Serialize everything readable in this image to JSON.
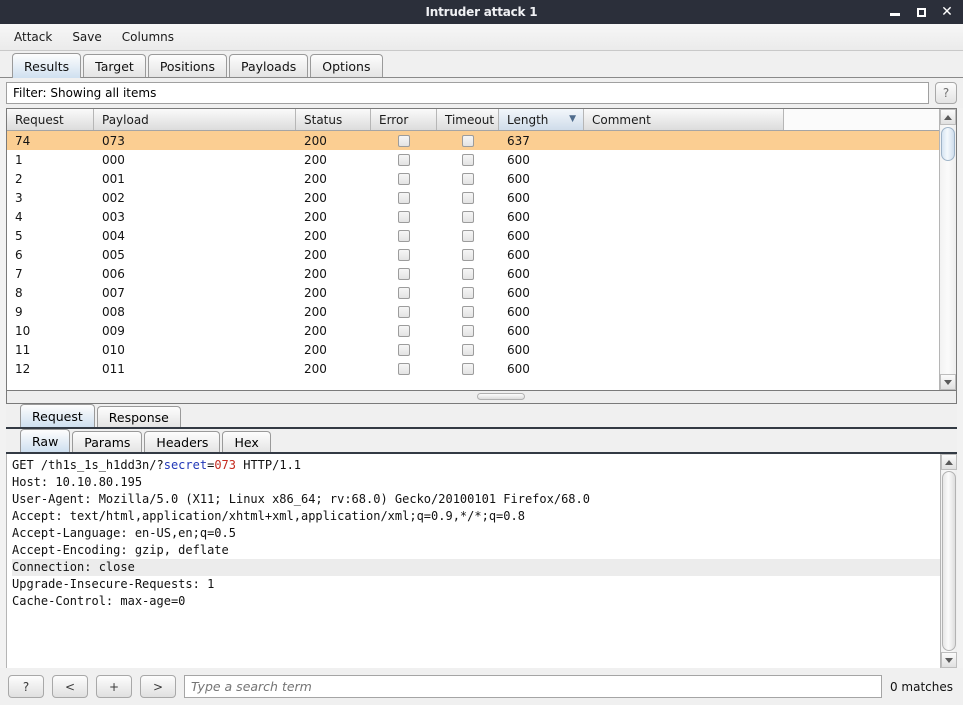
{
  "window": {
    "title": "Intruder attack 1",
    "minimize_label": "–",
    "maximize_label": "□",
    "close_label": "✕"
  },
  "menubar": {
    "items": [
      "Attack",
      "Save",
      "Columns"
    ]
  },
  "tabs": {
    "items": [
      "Results",
      "Target",
      "Positions",
      "Payloads",
      "Options"
    ],
    "active": "Results"
  },
  "filter": {
    "text": "Filter: Showing all items",
    "help_label": "?"
  },
  "results_table": {
    "columns": [
      "Request",
      "Payload",
      "Status",
      "Error",
      "Timeout",
      "Length",
      "Comment"
    ],
    "sorted_column": "Length",
    "sort_arrow": "▼",
    "rows": [
      {
        "request": "74",
        "payload": "073",
        "status": "200",
        "error": false,
        "timeout": false,
        "length": "637",
        "comment": "",
        "selected": true
      },
      {
        "request": "1",
        "payload": "000",
        "status": "200",
        "error": false,
        "timeout": false,
        "length": "600",
        "comment": "",
        "selected": false
      },
      {
        "request": "2",
        "payload": "001",
        "status": "200",
        "error": false,
        "timeout": false,
        "length": "600",
        "comment": "",
        "selected": false
      },
      {
        "request": "3",
        "payload": "002",
        "status": "200",
        "error": false,
        "timeout": false,
        "length": "600",
        "comment": "",
        "selected": false
      },
      {
        "request": "4",
        "payload": "003",
        "status": "200",
        "error": false,
        "timeout": false,
        "length": "600",
        "comment": "",
        "selected": false
      },
      {
        "request": "5",
        "payload": "004",
        "status": "200",
        "error": false,
        "timeout": false,
        "length": "600",
        "comment": "",
        "selected": false
      },
      {
        "request": "6",
        "payload": "005",
        "status": "200",
        "error": false,
        "timeout": false,
        "length": "600",
        "comment": "",
        "selected": false
      },
      {
        "request": "7",
        "payload": "006",
        "status": "200",
        "error": false,
        "timeout": false,
        "length": "600",
        "comment": "",
        "selected": false
      },
      {
        "request": "8",
        "payload": "007",
        "status": "200",
        "error": false,
        "timeout": false,
        "length": "600",
        "comment": "",
        "selected": false
      },
      {
        "request": "9",
        "payload": "008",
        "status": "200",
        "error": false,
        "timeout": false,
        "length": "600",
        "comment": "",
        "selected": false
      },
      {
        "request": "10",
        "payload": "009",
        "status": "200",
        "error": false,
        "timeout": false,
        "length": "600",
        "comment": "",
        "selected": false
      },
      {
        "request": "11",
        "payload": "010",
        "status": "200",
        "error": false,
        "timeout": false,
        "length": "600",
        "comment": "",
        "selected": false
      },
      {
        "request": "12",
        "payload": "011",
        "status": "200",
        "error": false,
        "timeout": false,
        "length": "600",
        "comment": "",
        "selected": false
      }
    ]
  },
  "message_panel": {
    "tabs": [
      "Request",
      "Response"
    ],
    "active_tab": "Request",
    "format_tabs": [
      "Raw",
      "Params",
      "Headers",
      "Hex"
    ],
    "active_format": "Raw",
    "request_lines": [
      {
        "segments": [
          {
            "text": "GET /th1s_1s_h1dd3n/?",
            "style": "plain"
          },
          {
            "text": "secret",
            "style": "key"
          },
          {
            "text": "=",
            "style": "plain"
          },
          {
            "text": "073",
            "style": "val"
          },
          {
            "text": " HTTP/1.1",
            "style": "plain"
          }
        ],
        "highlight": false
      },
      {
        "segments": [
          {
            "text": "Host: 10.10.80.195",
            "style": "plain"
          }
        ],
        "highlight": false
      },
      {
        "segments": [
          {
            "text": "User-Agent: Mozilla/5.0 (X11; Linux x86_64; rv:68.0) Gecko/20100101 Firefox/68.0",
            "style": "plain"
          }
        ],
        "highlight": false
      },
      {
        "segments": [
          {
            "text": "Accept: text/html,application/xhtml+xml,application/xml;q=0.9,*/*;q=0.8",
            "style": "plain"
          }
        ],
        "highlight": false
      },
      {
        "segments": [
          {
            "text": "Accept-Language: en-US,en;q=0.5",
            "style": "plain"
          }
        ],
        "highlight": false
      },
      {
        "segments": [
          {
            "text": "Accept-Encoding: gzip, deflate",
            "style": "plain"
          }
        ],
        "highlight": false
      },
      {
        "segments": [
          {
            "text": "Connection: close",
            "style": "plain"
          }
        ],
        "highlight": true
      },
      {
        "segments": [
          {
            "text": "Upgrade-Insecure-Requests: 1",
            "style": "plain"
          }
        ],
        "highlight": false
      },
      {
        "segments": [
          {
            "text": "Cache-Control: max-age=0",
            "style": "plain"
          }
        ],
        "highlight": false
      }
    ]
  },
  "search_bar": {
    "help_label": "?",
    "prev_label": "<",
    "add_label": "+",
    "next_label": ">",
    "placeholder": "Type a search term",
    "value": "",
    "matches": "0 matches"
  },
  "colors": {
    "selection": "#fbce92",
    "titlebar": "#2b2f3a",
    "accent_tab": "#cfe0f0",
    "token_key": "#2138b8",
    "token_value": "#c52b1f"
  }
}
